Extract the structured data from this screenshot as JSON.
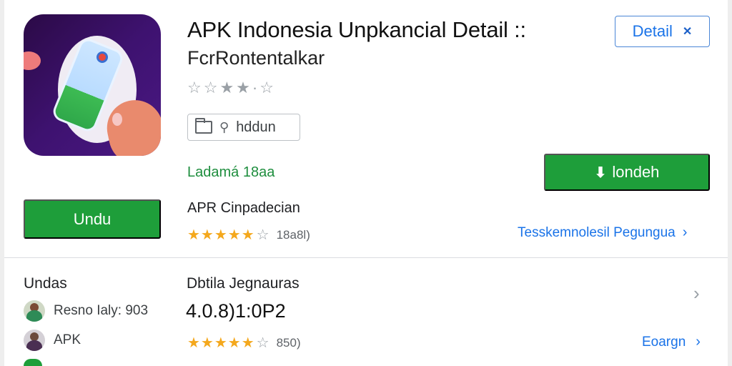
{
  "header": {
    "title": "APK Indonesia Unpkancial Detail ::",
    "subtitle": "FcrRontentalkar",
    "gray_stars": "☆☆★★·☆",
    "detail_button": "Detail",
    "detail_button_icon": "close-icon",
    "tag_chip_label": "hddun",
    "green_label": "Ladamá 18aa",
    "install_button": "londeh",
    "install_icon": "download-icon"
  },
  "left": {
    "undu_button": "Undu",
    "icon_colors": {
      "background": "#3e1270",
      "screen": "#cde6ff",
      "accent": "#1e9e3a"
    }
  },
  "developer": {
    "name": "APR Cinpadecian",
    "stars_filled": "★★★★★",
    "star_empty": "☆",
    "rating_count": "18a8l)",
    "link_text": "Tesskemnolesil Pegungua"
  },
  "section": {
    "left_heading": "Undas",
    "right_heading": "Dbtila Jegnauras",
    "items": [
      {
        "label": "Resno Ialy: 903"
      },
      {
        "label": "APK"
      }
    ],
    "version": "4.0.8)1:0P2",
    "stars_filled": "★★★★★",
    "star_empty": "☆",
    "rating_count": "850)",
    "link_text": "Eoargn"
  },
  "colors": {
    "accent_green": "#1e9e3a",
    "link_blue": "#1a73e8",
    "star_gold": "#f4a81d"
  }
}
